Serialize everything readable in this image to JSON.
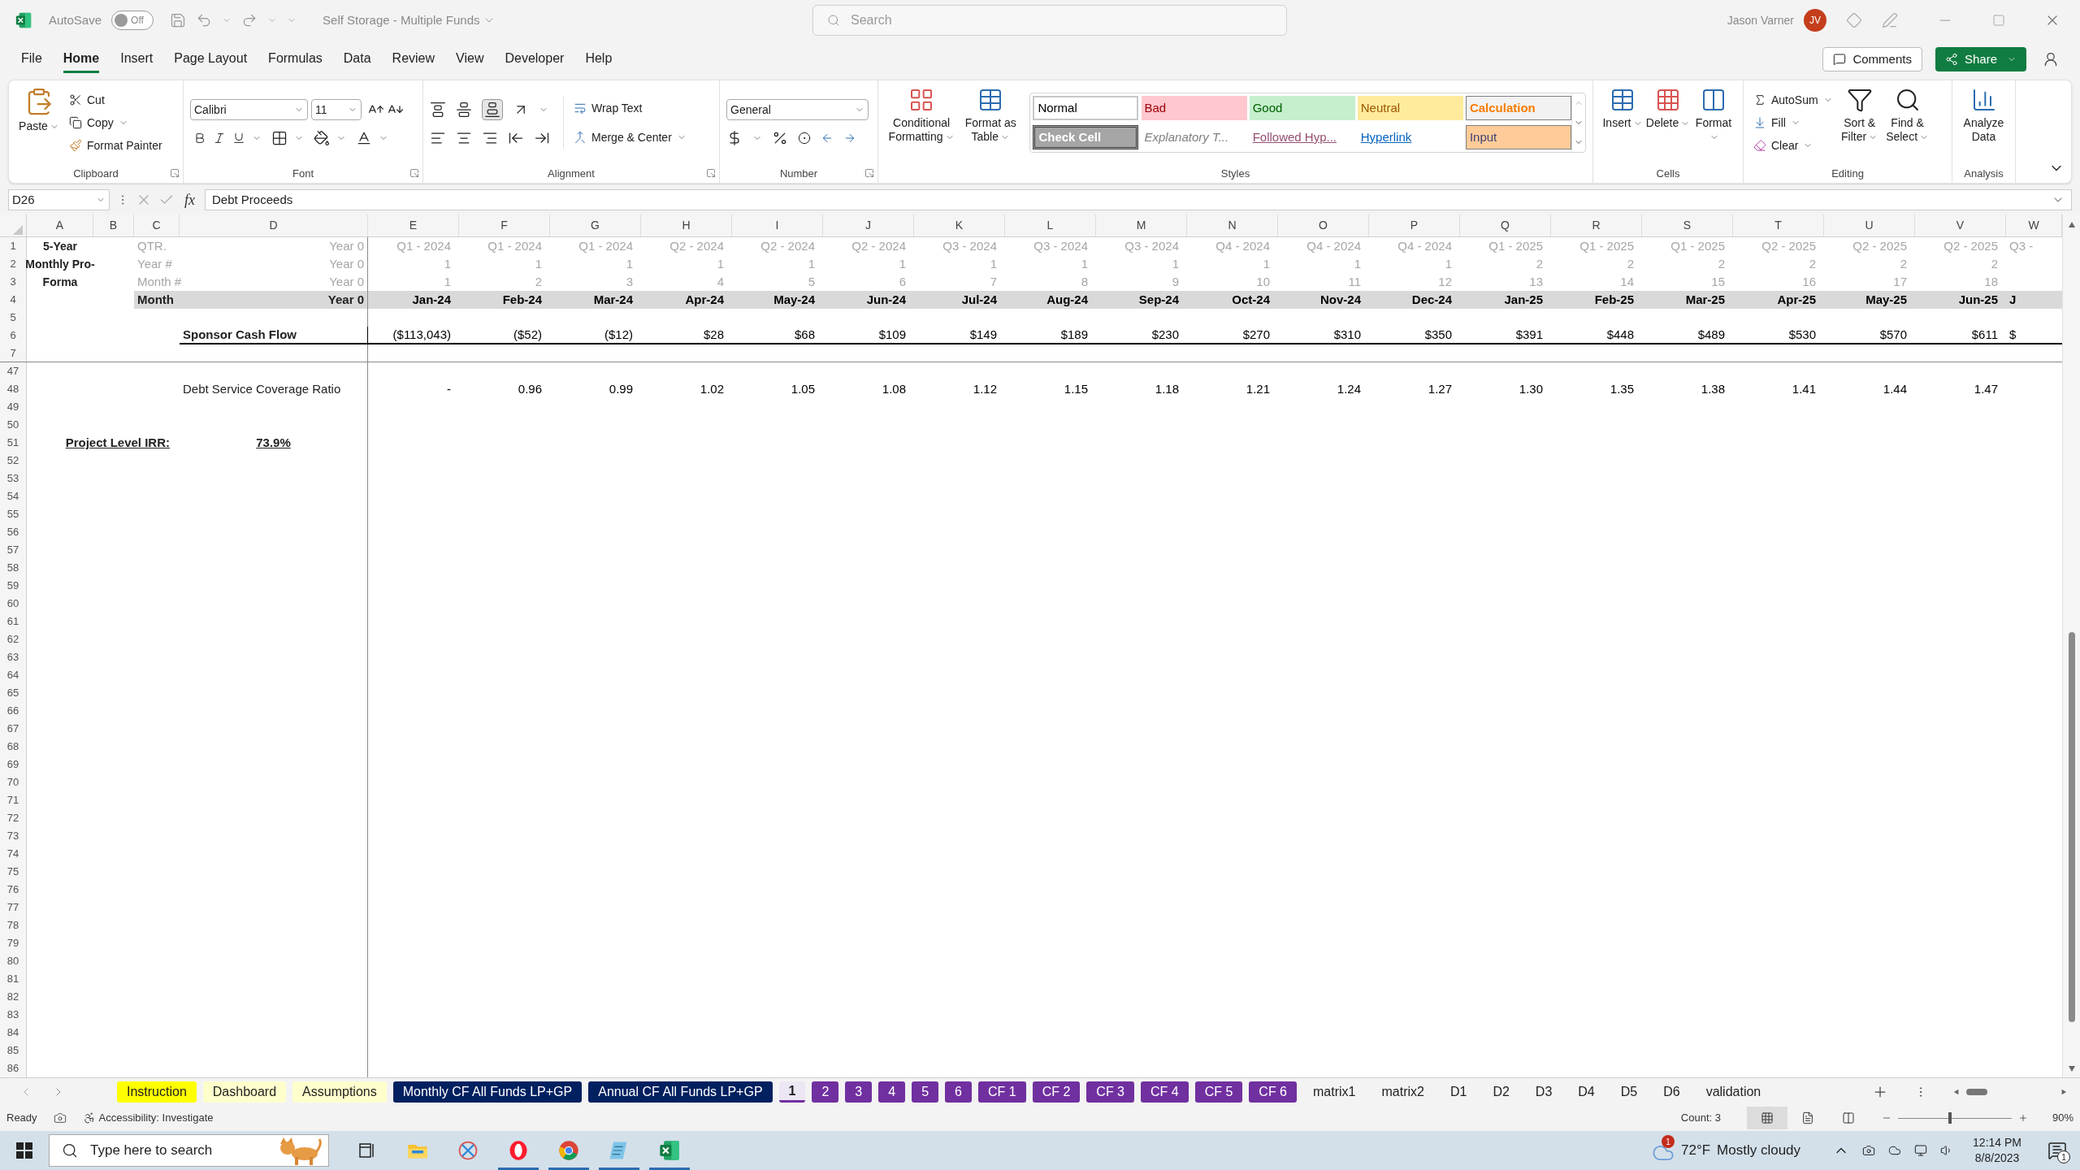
{
  "title_bar": {
    "autosave_label": "AutoSave",
    "autosave_on": false,
    "autosave_state": "Off",
    "document_title": "Self Storage - Multiple Funds",
    "search_placeholder": "Search",
    "user_name": "Jason Varner",
    "user_initials": "JV"
  },
  "ribbon_tabs": [
    {
      "label": "File",
      "selected": false
    },
    {
      "label": "Home",
      "selected": true
    },
    {
      "label": "Insert",
      "selected": false
    },
    {
      "label": "Page Layout",
      "selected": false
    },
    {
      "label": "Formulas",
      "selected": false
    },
    {
      "label": "Data",
      "selected": false
    },
    {
      "label": "Review",
      "selected": false
    },
    {
      "label": "View",
      "selected": false
    },
    {
      "label": "Developer",
      "selected": false
    },
    {
      "label": "Help",
      "selected": false
    }
  ],
  "comments_button": "Comments",
  "share_button": "Share",
  "ribbon": {
    "clipboard": {
      "paste": "Paste",
      "cut": "Cut",
      "copy": "Copy",
      "format_painter": "Format Painter",
      "label": "Clipboard"
    },
    "font": {
      "family": "Calibri",
      "size": "11",
      "label": "Font"
    },
    "alignment": {
      "wrap_text": "Wrap Text",
      "merge_center": "Merge & Center",
      "label": "Alignment"
    },
    "number": {
      "format": "General",
      "label": "Number"
    },
    "styles": {
      "conditional_formatting": "Conditional Formatting",
      "format_as_table": "Format as Table",
      "label": "Styles",
      "gallery": [
        {
          "label": "Normal",
          "kind": "normal"
        },
        {
          "label": "Bad",
          "kind": "bad"
        },
        {
          "label": "Good",
          "kind": "good"
        },
        {
          "label": "Neutral",
          "kind": "neutral"
        },
        {
          "label": "Calculation",
          "kind": "calculation"
        },
        {
          "label": "Check Cell",
          "kind": "check"
        },
        {
          "label": "Explanatory T...",
          "kind": "explanatory"
        },
        {
          "label": "Followed Hyp...",
          "kind": "followed"
        },
        {
          "label": "Hyperlink",
          "kind": "hyperlink"
        },
        {
          "label": "Input",
          "kind": "input"
        }
      ]
    },
    "cells": {
      "insert": "Insert",
      "delete": "Delete",
      "format": "Format",
      "label": "Cells"
    },
    "editing": {
      "autosum": "AutoSum",
      "fill": "Fill",
      "clear": "Clear",
      "sort_filter": "Sort & Filter",
      "find_select": "Find & Select",
      "label": "Editing"
    },
    "analysis": {
      "analyze_data": "Analyze Data",
      "label": "Analysis"
    }
  },
  "formula_bar": {
    "name_box": "D26",
    "fx": "fx",
    "formula": "Debt Proceeds"
  },
  "sheet": {
    "columns": [
      "A",
      "B",
      "C",
      "D",
      "E",
      "F",
      "G",
      "H",
      "I",
      "J",
      "K",
      "L",
      "M",
      "N",
      "O",
      "P",
      "Q",
      "R",
      "S",
      "T",
      "U",
      "V",
      "W"
    ],
    "frozen_rows": [
      {
        "number": "1",
        "kind": "meta",
        "a": "5-Year",
        "c": "QTR.",
        "d": "Year 0",
        "values": [
          "Q1 - 2024",
          "Q1 - 2024",
          "Q1 - 2024",
          "Q2 - 2024",
          "Q2 - 2024",
          "Q2 - 2024",
          "Q3 - 2024",
          "Q3 - 2024",
          "Q3 - 2024",
          "Q4 - 2024",
          "Q4 - 2024",
          "Q4 - 2024",
          "Q1 - 2025",
          "Q1 - 2025",
          "Q1 - 2025",
          "Q2 - 2025",
          "Q2 - 2025",
          "Q2 - 2025",
          "Q3 -"
        ]
      },
      {
        "number": "2",
        "kind": "meta",
        "a": "Monthly Pro-",
        "c": "Year #",
        "d": "Year 0",
        "values": [
          "1",
          "1",
          "1",
          "1",
          "1",
          "1",
          "1",
          "1",
          "1",
          "1",
          "1",
          "1",
          "2",
          "2",
          "2",
          "2",
          "2",
          "2"
        ]
      },
      {
        "number": "3",
        "kind": "meta",
        "a": "Forma",
        "c": "Month #",
        "d": "Year 0",
        "values": [
          "1",
          "2",
          "3",
          "4",
          "5",
          "6",
          "7",
          "8",
          "9",
          "10",
          "11",
          "12",
          "13",
          "14",
          "15",
          "16",
          "17",
          "18"
        ]
      },
      {
        "number": "4",
        "kind": "month",
        "c": "Month",
        "d": "Year 0",
        "values": [
          "Jan-24",
          "Feb-24",
          "Mar-24",
          "Apr-24",
          "May-24",
          "Jun-24",
          "Jul-24",
          "Aug-24",
          "Sep-24",
          "Oct-24",
          "Nov-24",
          "Dec-24",
          "Jan-25",
          "Feb-25",
          "Mar-25",
          "Apr-25",
          "May-25",
          "Jun-25",
          "J"
        ]
      },
      {
        "number": "5",
        "kind": "blank"
      },
      {
        "number": "6",
        "kind": "cashflow",
        "d": "Sponsor Cash Flow",
        "values": [
          "($113,043)",
          "($52)",
          "($12)",
          "$28",
          "$68",
          "$109",
          "$149",
          "$189",
          "$230",
          "$270",
          "$310",
          "$350",
          "$391",
          "$448",
          "$489",
          "$530",
          "$570",
          "$611",
          "$"
        ]
      },
      {
        "number": "7",
        "kind": "blank"
      }
    ],
    "rows": [
      {
        "number": "47",
        "kind": "blank"
      },
      {
        "number": "48",
        "kind": "ratio",
        "d": "Debt Service Coverage Ratio",
        "values": [
          "-",
          "0.96",
          "0.99",
          "1.02",
          "1.05",
          "1.08",
          "1.12",
          "1.15",
          "1.18",
          "1.21",
          "1.24",
          "1.27",
          "1.30",
          "1.35",
          "1.38",
          "1.41",
          "1.44",
          "1.47"
        ]
      },
      {
        "number": "49",
        "kind": "blank"
      },
      {
        "number": "50",
        "kind": "blank"
      },
      {
        "number": "51",
        "kind": "irr",
        "label": "Project Level IRR:",
        "value": "73.9%"
      },
      {
        "number": "52",
        "kind": "blank"
      },
      {
        "number": "53",
        "kind": "blank"
      },
      {
        "number": "54",
        "kind": "blank"
      },
      {
        "number": "55",
        "kind": "blank"
      },
      {
        "number": "56",
        "kind": "blank"
      },
      {
        "number": "57",
        "kind": "blank"
      },
      {
        "number": "58",
        "kind": "blank"
      },
      {
        "number": "59",
        "kind": "blank"
      },
      {
        "number": "60",
        "kind": "blank"
      },
      {
        "number": "61",
        "kind": "blank"
      },
      {
        "number": "62",
        "kind": "blank"
      },
      {
        "number": "63",
        "kind": "blank"
      },
      {
        "number": "64",
        "kind": "blank"
      },
      {
        "number": "65",
        "kind": "blank"
      },
      {
        "number": "66",
        "kind": "blank"
      },
      {
        "number": "67",
        "kind": "blank"
      },
      {
        "number": "68",
        "kind": "blank"
      },
      {
        "number": "69",
        "kind": "blank"
      },
      {
        "number": "70",
        "kind": "blank"
      },
      {
        "number": "71",
        "kind": "blank"
      },
      {
        "number": "72",
        "kind": "blank"
      },
      {
        "number": "73",
        "kind": "blank"
      },
      {
        "number": "74",
        "kind": "blank"
      },
      {
        "number": "75",
        "kind": "blank"
      },
      {
        "number": "76",
        "kind": "blank"
      },
      {
        "number": "77",
        "kind": "blank"
      },
      {
        "number": "78",
        "kind": "blank"
      },
      {
        "number": "79",
        "kind": "blank"
      },
      {
        "number": "80",
        "kind": "blank"
      },
      {
        "number": "81",
        "kind": "blank"
      },
      {
        "number": "82",
        "kind": "blank"
      },
      {
        "number": "83",
        "kind": "blank"
      },
      {
        "number": "84",
        "kind": "blank"
      },
      {
        "number": "85",
        "kind": "blank"
      },
      {
        "number": "86",
        "kind": "blank"
      }
    ]
  },
  "sheet_tabs": [
    {
      "label": "Instruction",
      "selected": false,
      "color": "#ffff00"
    },
    {
      "label": "Dashboard",
      "selected": false,
      "color": "#ffffcc"
    },
    {
      "label": "Assumptions",
      "selected": false,
      "color": "#ffffcc"
    },
    {
      "label": "Monthly CF All Funds LP+GP",
      "selected": false,
      "color": "#002060"
    },
    {
      "label": "Annual CF All Funds LP+GP",
      "selected": false,
      "color": "#002060"
    },
    {
      "label": "1",
      "selected": true,
      "color": "#7030a0"
    },
    {
      "label": "2",
      "selected": false,
      "color": "#7030a0"
    },
    {
      "label": "3",
      "selected": false,
      "color": "#7030a0"
    },
    {
      "label": "4",
      "selected": false,
      "color": "#7030a0"
    },
    {
      "label": "5",
      "selected": false,
      "color": "#7030a0"
    },
    {
      "label": "6",
      "selected": false,
      "color": "#7030a0"
    },
    {
      "label": "CF 1",
      "selected": false,
      "color": "#7030a0"
    },
    {
      "label": "CF 2",
      "selected": false,
      "color": "#7030a0"
    },
    {
      "label": "CF 3",
      "selected": false,
      "color": "#7030a0"
    },
    {
      "label": "CF 4",
      "selected": false,
      "color": "#7030a0"
    },
    {
      "label": "CF 5",
      "selected": false,
      "color": "#7030a0"
    },
    {
      "label": "CF 6",
      "selected": false,
      "color": "#7030a0"
    },
    {
      "label": "matrix1",
      "selected": false
    },
    {
      "label": "matrix2",
      "selected": false
    },
    {
      "label": "D1",
      "selected": false
    },
    {
      "label": "D2",
      "selected": false
    },
    {
      "label": "D3",
      "selected": false
    },
    {
      "label": "D4",
      "selected": false
    },
    {
      "label": "D5",
      "selected": false
    },
    {
      "label": "D6",
      "selected": false
    },
    {
      "label": "validation",
      "selected": false
    }
  ],
  "status_bar": {
    "mode": "Ready",
    "accessibility": "Accessibility: Investigate",
    "count": "Count: 3",
    "views": [
      {
        "kind": "normal",
        "selected": true
      },
      {
        "kind": "page_layout",
        "selected": false
      },
      {
        "kind": "page_break",
        "selected": false
      }
    ],
    "zoom": {
      "level": 0.44,
      "reading": "90%"
    }
  },
  "taskbar": {
    "search_placeholder": "Type here to search",
    "apps": [
      {
        "kind": "task_view",
        "running": false
      },
      {
        "kind": "explorer",
        "running": false
      },
      {
        "kind": "snipping",
        "running": false
      },
      {
        "kind": "opera",
        "running": true
      },
      {
        "kind": "chrome",
        "running": true
      },
      {
        "kind": "notepad",
        "running": true
      },
      {
        "kind": "excel",
        "running": true
      }
    ],
    "weather": {
      "badge": "1",
      "temperature": "72°F",
      "condition": "Mostly cloudy"
    },
    "time": "12:14 PM",
    "date": "8/8/2023",
    "notification_count": "1"
  }
}
